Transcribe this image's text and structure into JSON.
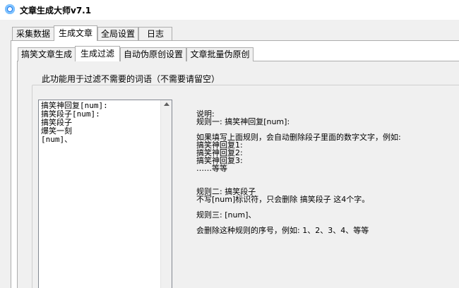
{
  "window": {
    "title": "文章生成大师v7.1"
  },
  "main_tabs": [
    {
      "label": "采集数据"
    },
    {
      "label": "生成文章"
    },
    {
      "label": "全局设置"
    },
    {
      "label": "日志"
    }
  ],
  "sub_tabs": [
    {
      "label": "搞笑文章生成"
    },
    {
      "label": "生成过滤"
    },
    {
      "label": "自动伪原创设置"
    },
    {
      "label": "文章批量伪原创"
    }
  ],
  "filter": {
    "group_title": "此功能用于过滤不需要的词语（不需要请留空）",
    "lines": [
      "搞笑神回复[num]:",
      "搞笑段子[num]:",
      "搞笑段子",
      "爆笑一刻",
      "[num]、"
    ]
  },
  "help": {
    "lines": [
      "说明:",
      "规则一: 搞笑神回复[num]:",
      "",
      "如果填写上面规则，会自动删除段子里面的数字文字，例如:",
      "搞笑神回复1:",
      "搞笑神回复2:",
      "搞笑神回复3:",
      "……等等",
      "",
      "",
      "规则二: 搞笑段子",
      "不写[num]标识符，只会删除 搞笑段子 这4个字。",
      "",
      "规则三: [num]、",
      "",
      "会删除这种规则的序号，例如: 1、2、3、4、等等"
    ]
  }
}
